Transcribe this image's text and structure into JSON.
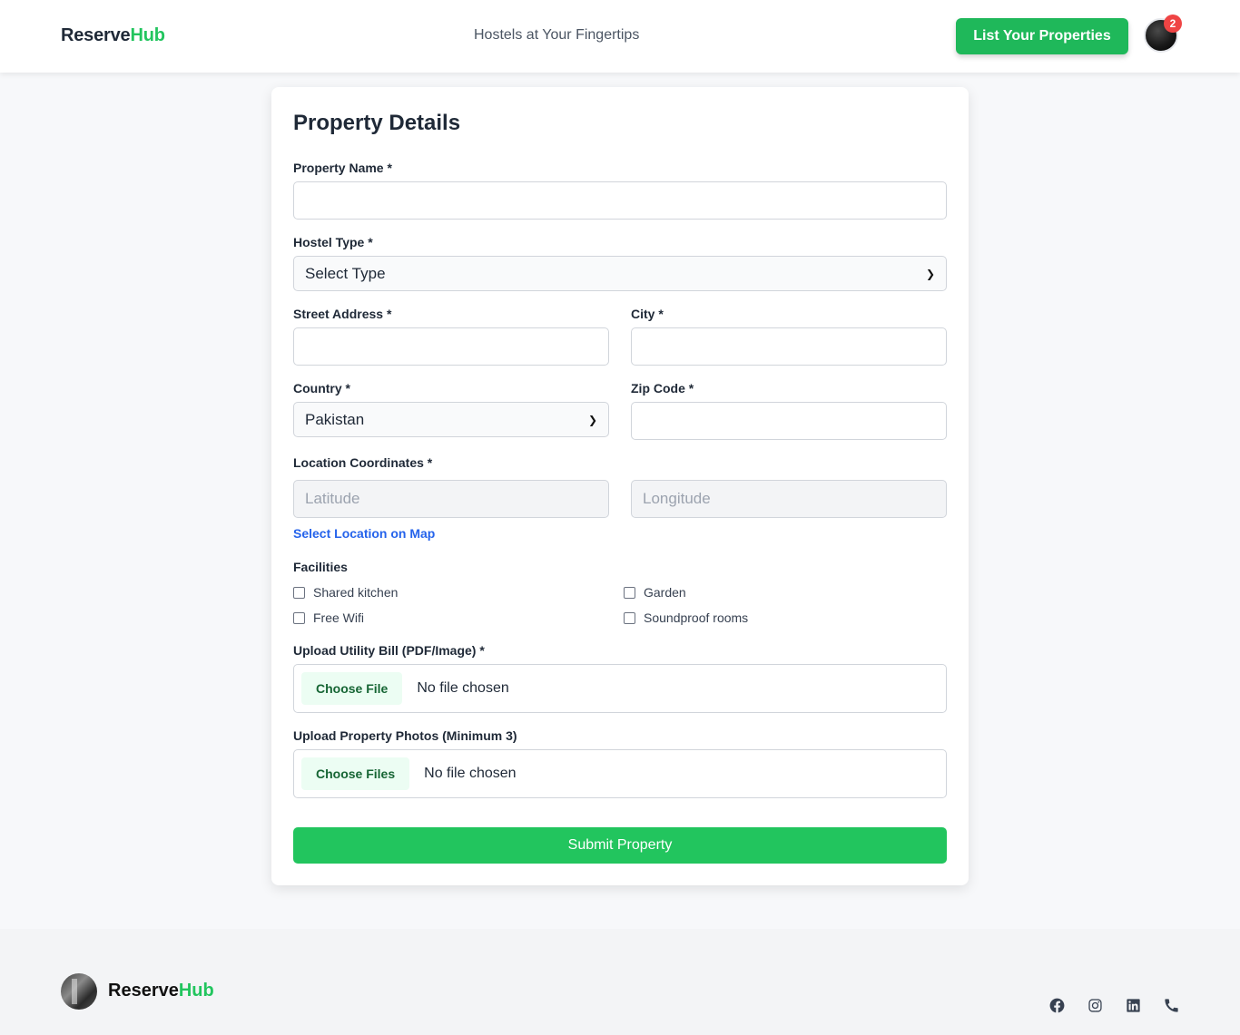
{
  "header": {
    "brand_prefix": "Reserve",
    "brand_suffix": "Hub",
    "tagline": "Hostels at Your Fingertips",
    "list_button": "List Your Properties",
    "notification_count": "2"
  },
  "form": {
    "title": "Property Details",
    "property_name_label": "Property Name *",
    "property_name_value": "",
    "hostel_type_label": "Hostel Type *",
    "hostel_type_selected": "Select Type",
    "street_label": "Street Address *",
    "street_value": "",
    "city_label": "City *",
    "city_value": "",
    "country_label": "Country *",
    "country_selected": "Pakistan",
    "zip_label": "Zip Code *",
    "zip_value": "",
    "coords_label": "Location Coordinates *",
    "latitude_placeholder": "Latitude",
    "longitude_placeholder": "Longitude",
    "map_link": "Select Location on Map",
    "facilities_label": "Facilities",
    "facilities": [
      {
        "label": "Shared kitchen",
        "checked": false
      },
      {
        "label": "Garden",
        "checked": false
      },
      {
        "label": "Free Wifi",
        "checked": false
      },
      {
        "label": "Soundproof rooms",
        "checked": false
      }
    ],
    "utility_label": "Upload Utility Bill (PDF/Image) *",
    "utility_button": "Choose File",
    "utility_status": "No file chosen",
    "photos_label": "Upload Property Photos (Minimum 3)",
    "photos_button": "Choose Files",
    "photos_status": "No file chosen",
    "submit_label": "Submit Property"
  },
  "footer": {
    "brand_prefix": "Reserve",
    "brand_suffix": "Hub",
    "social_icons": [
      "facebook-icon",
      "instagram-icon",
      "linkedin-icon",
      "phone-icon"
    ]
  },
  "colors": {
    "accent": "#22c55e",
    "link": "#2563eb",
    "badge": "#ef4444"
  }
}
